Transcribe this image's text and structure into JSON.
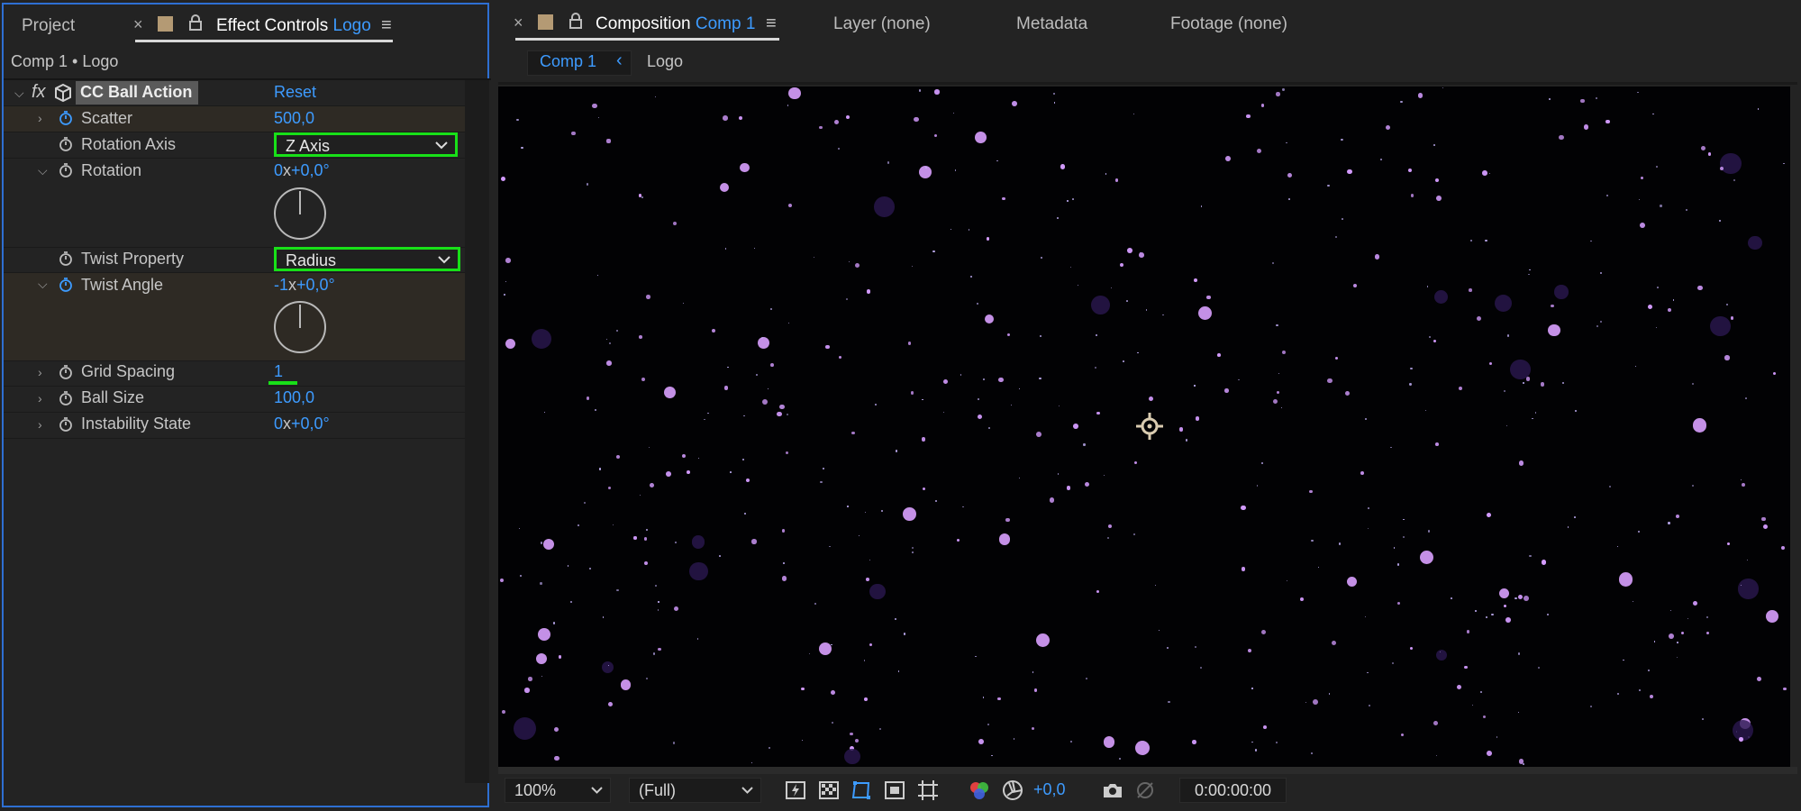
{
  "left_panel": {
    "tabs": {
      "project": "Project",
      "close": "×",
      "effect_controls_label": "Effect Controls",
      "effect_controls_layer": "Logo",
      "menu": "≡"
    },
    "breadcrumb": "Comp 1 • Logo",
    "effect": {
      "fx": "fx",
      "name": "CC Ball Action",
      "reset": "Reset"
    },
    "properties": {
      "scatter": {
        "label": "Scatter",
        "value": "500,0"
      },
      "rotation_axis": {
        "label": "Rotation Axis",
        "value": "Z Axis"
      },
      "rotation": {
        "label": "Rotation",
        "value_rev": "0",
        "value_x": "x",
        "value_deg": "+0,0°"
      },
      "twist_property": {
        "label": "Twist Property",
        "value": "Radius"
      },
      "twist_angle": {
        "label": "Twist Angle",
        "value_rev": "-1",
        "value_x": "x",
        "value_deg": "+0,0°"
      },
      "grid_spacing": {
        "label": "Grid Spacing",
        "value": "1"
      },
      "ball_size": {
        "label": "Ball Size",
        "value": "100,0"
      },
      "instability_state": {
        "label": "Instability State",
        "value_rev": "0",
        "value_x": "x",
        "value_deg": "+0,0°"
      }
    }
  },
  "right_panel": {
    "tabs": {
      "close": "×",
      "composition_label": "Composition",
      "composition_name": "Comp 1",
      "menu": "≡",
      "layer": "Layer (none)",
      "metadata": "Metadata",
      "footage": "Footage (none)"
    },
    "breadcrumb": {
      "comp": "Comp 1",
      "arrow": "‹",
      "layer": "Logo"
    },
    "bottom_bar": {
      "zoom": "100%",
      "resolution": "(Full)",
      "exposure": "+0,0",
      "timecode": "0:00:00:00"
    }
  },
  "colors": {
    "accent_blue": "#3d9bff",
    "highlight_green": "#18e018",
    "particle": "#d9a0ff",
    "panel_border": "#2e6fd2"
  }
}
